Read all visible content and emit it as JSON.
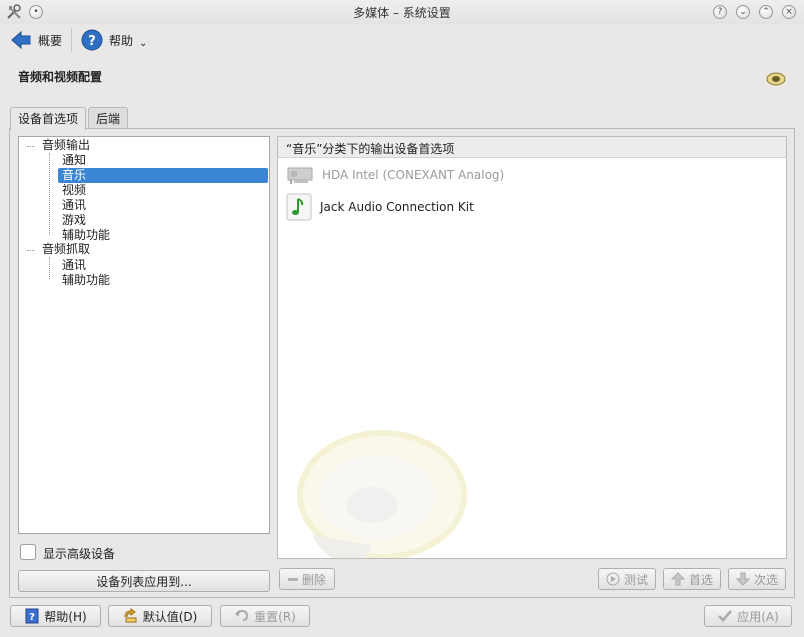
{
  "window": {
    "title": "多媒体 – 系统设置"
  },
  "toolbar": {
    "overview_label": "概要",
    "help_label": "帮助"
  },
  "page": {
    "title": "音频和视频配置"
  },
  "tabs": [
    {
      "label": "设备首选项"
    },
    {
      "label": "后端"
    }
  ],
  "tree": {
    "audio_output": "音频输出",
    "output_children": [
      "通知",
      "音乐",
      "视频",
      "通讯",
      "游戏",
      "辅助功能"
    ],
    "audio_capture": "音频抓取",
    "capture_children": [
      "通讯",
      "辅助功能"
    ],
    "selected": "音乐"
  },
  "device_list": {
    "header": "“音乐”分类下的输出设备首选项",
    "devices": [
      {
        "name": "HDA Intel (CONEXANT Analog)",
        "icon": "sound-card-icon",
        "disabled": true
      },
      {
        "name": "Jack Audio Connection Kit",
        "icon": "music-note-icon",
        "disabled": false
      }
    ]
  },
  "options": {
    "show_advanced_label": "显示高级设备",
    "apply_to_label": "设备列表应用到..."
  },
  "actions": {
    "remove_label": "删除",
    "test_label": "测试",
    "prefer_label": "首选",
    "defer_label": "次选"
  },
  "footer": {
    "help_label": "帮助(H)",
    "defaults_label": "默认值(D)",
    "reset_label": "重置(R)",
    "apply_label": "应用(A)"
  },
  "colors": {
    "selection": "#3a86d4",
    "window_bg": "#e9e8e7"
  }
}
